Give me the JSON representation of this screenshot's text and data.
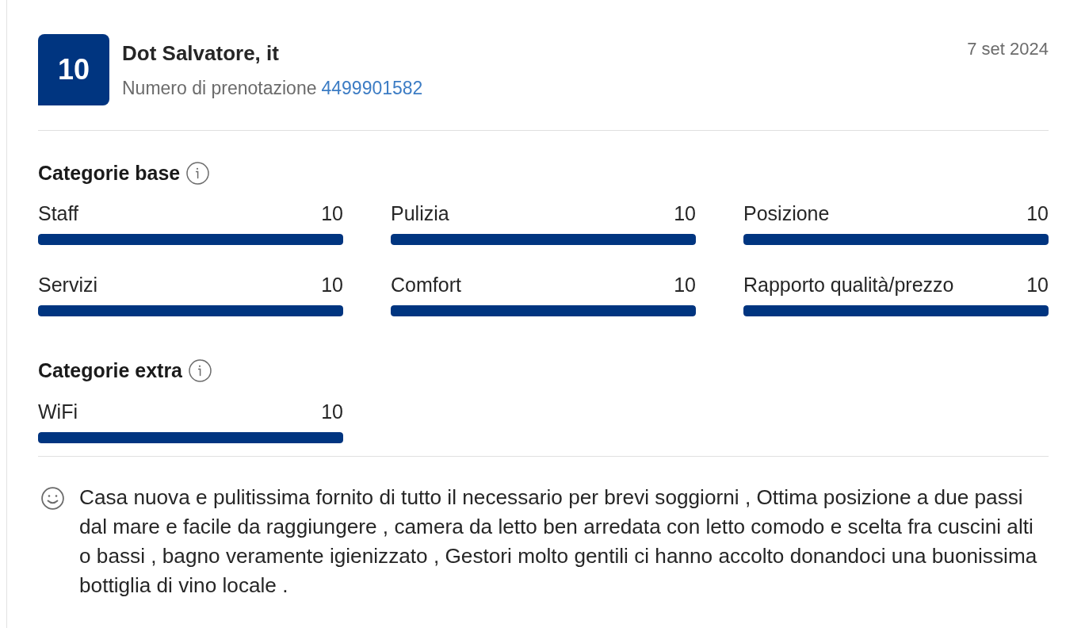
{
  "review": {
    "score": "10",
    "reviewer": "Dot Salvatore, it",
    "booking_label": "Numero di prenotazione",
    "booking_number": "4499901582",
    "date": "7 set 2024",
    "sections": [
      {
        "title": "Categorie base",
        "categories": [
          {
            "name": "Staff",
            "score": "10",
            "level": 1
          },
          {
            "name": "Pulizia",
            "score": "10",
            "level": 1
          },
          {
            "name": "Posizione",
            "score": "10",
            "level": 1
          },
          {
            "name": "Servizi",
            "score": "10",
            "level": 1
          },
          {
            "name": "Comfort",
            "score": "10",
            "level": 1
          },
          {
            "name": "Rapporto qualità/prezzo",
            "score": "10",
            "level": 1
          }
        ]
      },
      {
        "title": "Categorie extra",
        "categories": [
          {
            "name": "WiFi",
            "score": "10",
            "level": 1
          }
        ]
      }
    ],
    "comment": "Casa nuova e pulitissima fornito di tutto il necessario per brevi soggiorni , Ottima posizione a due passi dal mare e facile da raggiungere , camera da letto ben arredata con letto comodo e scelta fra cuscini alti o bassi , bagno veramente igienizzato , Gestori molto gentili ci hanno accolto donandoci una buonissima bottiglia di vino locale ."
  }
}
